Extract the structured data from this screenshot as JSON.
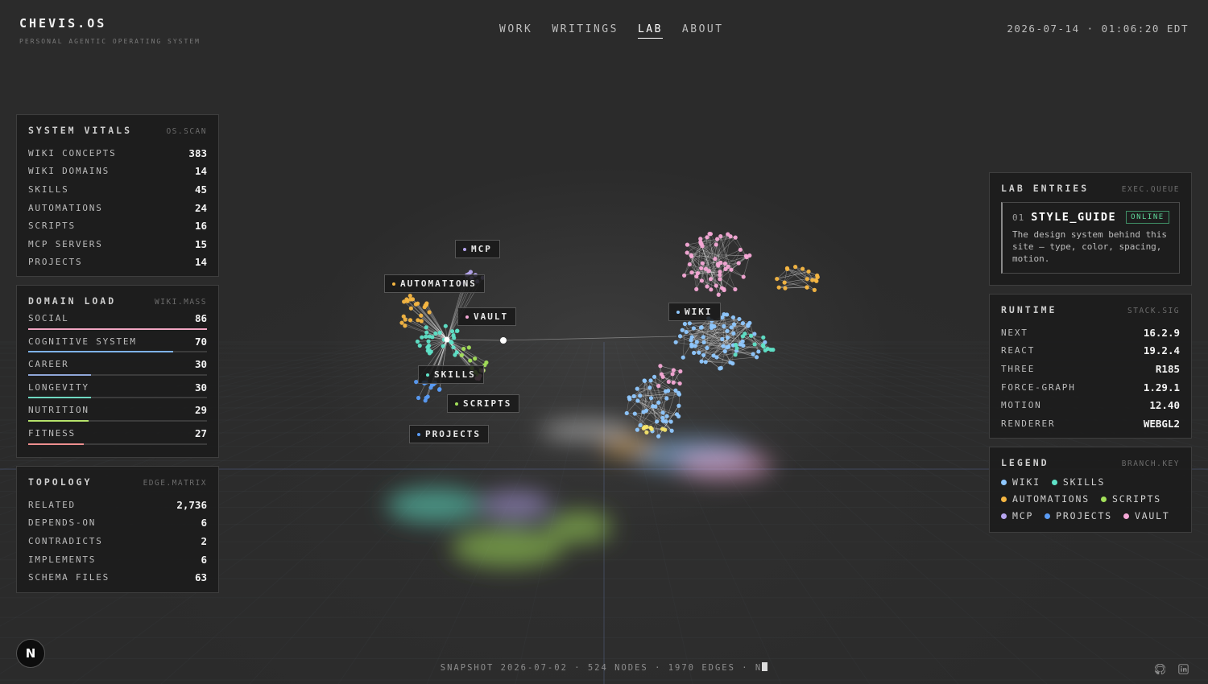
{
  "header": {
    "brand": "CHEVIS.OS",
    "tagline": "PERSONAL AGENTIC OPERATING SYSTEM",
    "nav": [
      {
        "label": "WORK",
        "active": false
      },
      {
        "label": "WRITINGS",
        "active": false
      },
      {
        "label": "LAB",
        "active": true
      },
      {
        "label": "ABOUT",
        "active": false
      }
    ],
    "clock": "2026-07-14 · 01:06:20 EDT"
  },
  "vitals": {
    "title": "SYSTEM VITALS",
    "tag": "OS.SCAN",
    "rows": [
      {
        "label": "WIKI CONCEPTS",
        "value": "383"
      },
      {
        "label": "WIKI DOMAINS",
        "value": "14"
      },
      {
        "label": "SKILLS",
        "value": "45"
      },
      {
        "label": "AUTOMATIONS",
        "value": "24"
      },
      {
        "label": "SCRIPTS",
        "value": "16"
      },
      {
        "label": "MCP SERVERS",
        "value": "15"
      },
      {
        "label": "PROJECTS",
        "value": "14"
      }
    ]
  },
  "domain_load": {
    "title": "DOMAIN LOAD",
    "tag": "WIKI.MASS",
    "rows": [
      {
        "label": "SOCIAL",
        "value": "86",
        "fraction": 1.0,
        "color": "#f2a7c3"
      },
      {
        "label": "COGNITIVE SYSTEM",
        "value": "70",
        "fraction": 0.81,
        "color": "#7fb2e8"
      },
      {
        "label": "CAREER",
        "value": "30",
        "fraction": 0.35,
        "color": "#8fa6d8"
      },
      {
        "label": "LONGEVITY",
        "value": "30",
        "fraction": 0.35,
        "color": "#6fd9c2"
      },
      {
        "label": "NUTRITION",
        "value": "29",
        "fraction": 0.34,
        "color": "#b6e36b"
      },
      {
        "label": "FITNESS",
        "value": "27",
        "fraction": 0.31,
        "color": "#ef8f8f"
      }
    ]
  },
  "topology": {
    "title": "TOPOLOGY",
    "tag": "EDGE.MATRIX",
    "rows": [
      {
        "label": "RELATED",
        "value": "2,736"
      },
      {
        "label": "DEPENDS-ON",
        "value": "6"
      },
      {
        "label": "CONTRADICTS",
        "value": "2"
      },
      {
        "label": "IMPLEMENTS",
        "value": "6"
      },
      {
        "label": "SCHEMA FILES",
        "value": "63"
      }
    ]
  },
  "lab_entries": {
    "title": "LAB ENTRIES",
    "tag": "EXEC.QUEUE",
    "entry": {
      "num": "01",
      "name": "STYLE_GUIDE",
      "status": "ONLINE",
      "desc": "The design system behind this site — type, color, spacing, motion."
    }
  },
  "runtime": {
    "title": "RUNTIME",
    "tag": "STACK.SIG",
    "rows": [
      {
        "label": "NEXT",
        "value": "16.2.9"
      },
      {
        "label": "REACT",
        "value": "19.2.4"
      },
      {
        "label": "THREE",
        "value": "R185"
      },
      {
        "label": "FORCE-GRAPH",
        "value": "1.29.1"
      },
      {
        "label": "MOTION",
        "value": "12.40"
      },
      {
        "label": "RENDERER",
        "value": "WEBGL2"
      }
    ]
  },
  "legend": {
    "title": "LEGEND",
    "tag": "BRANCH.KEY",
    "items": [
      {
        "label": "WIKI",
        "color": "#8fc8ff"
      },
      {
        "label": "SKILLS",
        "color": "#5fe3c8"
      },
      {
        "label": "AUTOMATIONS",
        "color": "#f5b642"
      },
      {
        "label": "SCRIPTS",
        "color": "#a3e05a"
      },
      {
        "label": "MCP",
        "color": "#b7a6f0"
      },
      {
        "label": "PROJECTS",
        "color": "#5a9cf5"
      },
      {
        "label": "VAULT",
        "color": "#f5a8d6"
      }
    ]
  },
  "graph_labels": {
    "mcp": "MCP",
    "automations": "AUTOMATIONS",
    "vault": "VAULT",
    "skills": "SKILLS",
    "scripts": "SCRIPTS",
    "projects": "PROJECTS",
    "wiki": "WIKI"
  },
  "footer": {
    "snapshot": "SNAPSHOT 2026-07-02 · 524 NODES · 1970 EDGES · N",
    "badge": "N"
  },
  "icons": {
    "github": "github-icon",
    "linkedin": "linkedin-icon"
  }
}
